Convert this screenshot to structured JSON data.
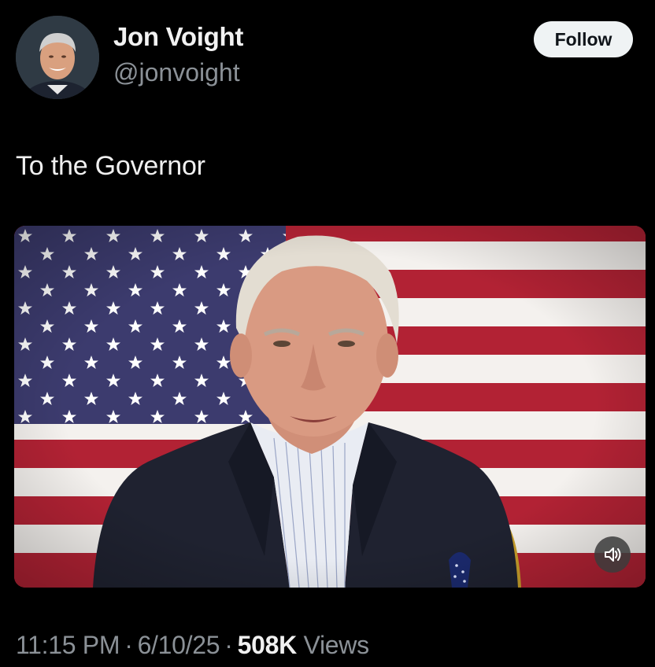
{
  "author": {
    "display_name": "Jon Voight",
    "handle": "@jonvoight",
    "avatar_icon": "profile-photo"
  },
  "follow_button": {
    "label": "Follow"
  },
  "tweet": {
    "text": "To the Governor"
  },
  "media": {
    "type": "video",
    "mute_icon": "speaker-muted-icon"
  },
  "meta": {
    "time": "11:15 PM",
    "separator": "·",
    "date": "6/10/25",
    "views_count": "508K",
    "views_label": "Views"
  },
  "colors": {
    "background": "#000000",
    "primary_text": "#e7e9ea",
    "secondary_text": "#8b9197",
    "follow_bg": "#eff3f4",
    "flag_red": "#b22234",
    "flag_blue": "#3c3b6e"
  }
}
